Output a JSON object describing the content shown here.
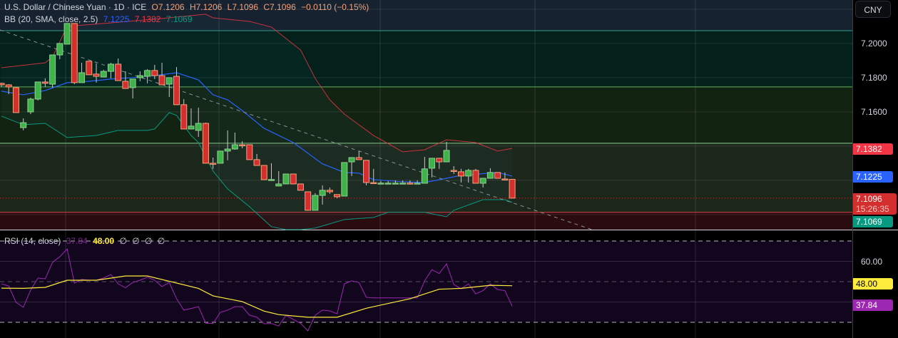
{
  "header": {
    "symbol": "U.S. Dollar / Chinese Yuan · 1D · ICE",
    "open": "O7.1206",
    "high": "H7.1206",
    "low": "L7.1096",
    "close": "C7.1096",
    "change": "−0.0110 (−0.15%)"
  },
  "bb_legend": {
    "label": "BB (20, SMA, close, 2.5)",
    "basis": "7.1225",
    "upper": "7.1382",
    "lower": "7.1069"
  },
  "rsi_legend": {
    "label": "RSI (14, close)",
    "rsi": "37.84",
    "ma": "48.00",
    "extras": [
      "∅",
      "∅",
      "∅",
      "∅"
    ]
  },
  "axis": {
    "currency": "CNY",
    "price_ticks": [
      "7.2000",
      "7.1800",
      "7.1600"
    ],
    "rsi_ticks": [
      "60.00"
    ],
    "tags": {
      "upper": "7.1382",
      "basis": "7.1225",
      "last": "7.1096",
      "countdown": "15:26:35",
      "lower": "7.1069",
      "rsi_ma": "48.00",
      "rsi": "37.84"
    }
  },
  "colors": {
    "up": "#3fb24a",
    "down": "#d32f2f",
    "basis": "#2962ff",
    "upper": "#f23645",
    "lower": "#089981",
    "rsi": "#9c27b0",
    "rsi_ma": "#ffeb3b"
  },
  "chart_data": {
    "type": "candlestick",
    "price_range": [
      7.0912,
      7.2254
    ],
    "levels": {
      "teal": 7.2075,
      "green1": 7.1746,
      "green2": 7.1417,
      "red": 7.1013
    },
    "ohlc": [
      [
        7.1767,
        7.1771,
        7.1746,
        7.1758
      ],
      [
        7.1758,
        7.1762,
        7.1704,
        7.1746
      ],
      [
        7.1742,
        7.1746,
        7.1596,
        7.1596
      ],
      [
        7.1508,
        7.1562,
        7.1492,
        7.1537
      ],
      [
        7.16,
        7.1683,
        7.1587,
        7.1675
      ],
      [
        7.1675,
        7.1775,
        7.1667,
        7.1775
      ],
      [
        7.1775,
        7.1796,
        7.1746,
        7.1767
      ],
      [
        7.1762,
        7.1933,
        7.1742,
        7.1933
      ],
      [
        7.1933,
        7.2,
        7.1908,
        7.2
      ],
      [
        7.1996,
        7.2117,
        7.1996,
        7.2117
      ],
      [
        7.2117,
        7.2117,
        7.1762,
        7.1771
      ],
      [
        7.1771,
        7.1887,
        7.1771,
        7.1829
      ],
      [
        7.1896,
        7.1896,
        7.1817,
        7.1817
      ],
      [
        7.1821,
        7.1883,
        7.1771,
        7.1808
      ],
      [
        7.1804,
        7.1846,
        7.1804,
        7.1837
      ],
      [
        7.1837,
        7.1887,
        7.1796,
        7.1879
      ],
      [
        7.1879,
        7.1912,
        7.1783,
        7.1783
      ],
      [
        7.1779,
        7.1837,
        7.1737,
        7.1737
      ],
      [
        7.1742,
        7.1792,
        7.1679,
        7.1792
      ],
      [
        7.18,
        7.1837,
        7.1779,
        7.1812
      ],
      [
        7.1808,
        7.185,
        7.1767,
        7.1842
      ],
      [
        7.1842,
        7.1875,
        7.1792,
        7.1812
      ],
      [
        7.1812,
        7.1887,
        7.1758,
        7.1758
      ],
      [
        7.1762,
        7.18,
        7.1687,
        7.18
      ],
      [
        7.1808,
        7.1862,
        7.1642,
        7.1642
      ],
      [
        7.1642,
        7.1675,
        7.15,
        7.15
      ],
      [
        7.15,
        7.1621,
        7.15,
        7.1517
      ],
      [
        7.1492,
        7.1625,
        7.1454,
        7.1533
      ],
      [
        7.1533,
        7.1537,
        7.13,
        7.13
      ],
      [
        7.13,
        7.1333,
        7.1267,
        7.1299
      ],
      [
        7.13,
        7.1371,
        7.13,
        7.1371
      ],
      [
        7.1371,
        7.1492,
        7.1317,
        7.1383
      ],
      [
        7.1383,
        7.1479,
        7.1379,
        7.1408
      ],
      [
        7.1408,
        7.1429,
        7.1387,
        7.1407
      ],
      [
        7.1408,
        7.1408,
        7.1321,
        7.1321
      ],
      [
        7.1321,
        7.1354,
        7.1287,
        7.1287
      ],
      [
        7.1287,
        7.1287,
        7.1204,
        7.1204
      ],
      [
        7.1204,
        7.13,
        7.1196,
        7.1205
      ],
      [
        7.1167,
        7.1254,
        7.1167,
        7.1179
      ],
      [
        7.1179,
        7.1237,
        7.1179,
        7.1237
      ],
      [
        7.1237,
        7.1237,
        7.1179,
        7.1179
      ],
      [
        7.1179,
        7.1179,
        7.1142,
        7.1142
      ],
      [
        7.1133,
        7.1133,
        7.1025,
        7.1025
      ],
      [
        7.1025,
        7.1125,
        7.1025,
        7.1112
      ],
      [
        7.1112,
        7.1171,
        7.1058,
        7.1142
      ],
      [
        7.1142,
        7.1158,
        7.1121,
        7.1133
      ],
      [
        7.1117,
        7.1117,
        7.1096,
        7.1104
      ],
      [
        7.1108,
        7.1304,
        7.1108,
        7.1304
      ],
      [
        7.1308,
        7.1333,
        7.1225,
        7.1333
      ],
      [
        7.1333,
        7.1371,
        7.1321,
        7.1321
      ],
      [
        7.1317,
        7.1317,
        7.1171,
        7.1187
      ],
      [
        7.1187,
        7.1267,
        7.1187,
        7.1186
      ],
      [
        7.1183,
        7.1196,
        7.1183,
        7.1184
      ],
      [
        7.1183,
        7.1196,
        7.1183,
        7.1184
      ],
      [
        7.1183,
        7.12,
        7.1183,
        7.1184
      ],
      [
        7.1183,
        7.12,
        7.1183,
        7.1184
      ],
      [
        7.1184,
        7.12,
        7.1183,
        7.1183
      ],
      [
        7.1183,
        7.12,
        7.1183,
        7.1184
      ],
      [
        7.1183,
        7.1337,
        7.1183,
        7.1267
      ],
      [
        7.1271,
        7.1329,
        7.1217,
        7.1329
      ],
      [
        7.1329,
        7.1329,
        7.1267,
        7.1308
      ],
      [
        7.1308,
        7.1425,
        7.1308,
        7.1375
      ],
      [
        7.1258,
        7.1283,
        7.1237,
        7.1257
      ],
      [
        7.125,
        7.1267,
        7.1187,
        7.1225
      ],
      [
        7.1225,
        7.1267,
        7.1187,
        7.1258
      ],
      [
        7.1258,
        7.1267,
        7.1183,
        7.1183
      ],
      [
        7.1183,
        7.1212,
        7.1158,
        7.1212
      ],
      [
        7.1212,
        7.1271,
        7.1212,
        7.1246
      ],
      [
        7.1246,
        7.1246,
        7.1212,
        7.1212
      ],
      [
        7.1208,
        7.1246,
        7.1204,
        7.1204
      ],
      [
        7.1206,
        7.1206,
        7.1096,
        7.1096
      ]
    ],
    "bb_basis": [
      [
        0,
        7.1721
      ],
      [
        3,
        7.17
      ],
      [
        6,
        7.1725
      ],
      [
        9,
        7.1771
      ],
      [
        12,
        7.1779
      ],
      [
        15,
        7.1792
      ],
      [
        18,
        7.18
      ],
      [
        21,
        7.1812
      ],
      [
        24,
        7.1829
      ],
      [
        27,
        7.1787
      ],
      [
        29,
        7.17
      ],
      [
        31,
        7.1671
      ],
      [
        33,
        7.1608
      ],
      [
        36,
        7.1504
      ],
      [
        40,
        7.1421
      ],
      [
        44,
        7.1296
      ],
      [
        47,
        7.1246
      ],
      [
        49,
        7.1242
      ],
      [
        51,
        7.1204
      ],
      [
        55,
        7.1192
      ],
      [
        58,
        7.1187
      ],
      [
        61,
        7.1212
      ],
      [
        63,
        7.1229
      ],
      [
        68,
        7.1246
      ],
      [
        70,
        7.1225
      ]
    ],
    "bb_upper": [
      [
        0,
        7.1858
      ],
      [
        6,
        7.1887
      ],
      [
        7,
        7.1921
      ],
      [
        9,
        7.21
      ],
      [
        14,
        7.2117
      ],
      [
        22,
        7.2146
      ],
      [
        28,
        7.2171
      ],
      [
        29,
        7.215
      ],
      [
        34,
        7.2129
      ],
      [
        37,
        7.2096
      ],
      [
        41,
        7.1962
      ],
      [
        43,
        7.1796
      ],
      [
        45,
        7.1671
      ],
      [
        47,
        7.1587
      ],
      [
        51,
        7.1462
      ],
      [
        55,
        7.1367
      ],
      [
        58,
        7.1379
      ],
      [
        61,
        7.1437
      ],
      [
        65,
        7.1421
      ],
      [
        68,
        7.1371
      ],
      [
        70,
        7.1387
      ]
    ],
    "bb_lower": [
      [
        0,
        7.1575
      ],
      [
        3,
        7.1525
      ],
      [
        6,
        7.1533
      ],
      [
        9,
        7.145
      ],
      [
        13,
        7.1462
      ],
      [
        16,
        7.1492
      ],
      [
        20,
        7.1492
      ],
      [
        21,
        7.15
      ],
      [
        23,
        7.1596
      ],
      [
        24,
        7.1579
      ],
      [
        26,
        7.1462
      ],
      [
        27,
        7.1421
      ],
      [
        29,
        7.1254
      ],
      [
        31,
        7.115
      ],
      [
        34,
        7.1046
      ],
      [
        37,
        7.0929
      ],
      [
        39,
        7.0912
      ],
      [
        41,
        7.0912
      ],
      [
        43,
        7.0921
      ],
      [
        47,
        7.0971
      ],
      [
        51,
        7.0983
      ],
      [
        53,
        7.1013
      ],
      [
        58,
        7.1013
      ],
      [
        61,
        7.0987
      ],
      [
        62,
        7.1025
      ],
      [
        66,
        7.1087
      ],
      [
        69,
        7.1087
      ],
      [
        70,
        7.1071
      ]
    ],
    "rsi": [
      48.9,
      47.9,
      39.8,
      37.4,
      45.8,
      51.8,
      51.4,
      59.5,
      62.3,
      66.1,
      49.3,
      51.1,
      50.7,
      50.7,
      51.8,
      53.5,
      48.9,
      47.0,
      49.6,
      50.7,
      52.2,
      50.7,
      47.6,
      49.6,
      41.6,
      36.0,
      36.8,
      37.7,
      29.6,
      29.4,
      34.9,
      36.0,
      37.7,
      37.7,
      33.5,
      32.5,
      29.3,
      29.4,
      28.2,
      33.5,
      31.4,
      29.5,
      25.8,
      33.5,
      36.0,
      35.6,
      34.2,
      48.9,
      50.4,
      49.6,
      42.3,
      42.0,
      42.0,
      42.0,
      42.0,
      42.0,
      42.0,
      42.0,
      50.4,
      55.9,
      54.0,
      58.8,
      48.6,
      46.5,
      48.9,
      44.0,
      45.6,
      48.9,
      46.1,
      45.6,
      37.84
    ],
    "rsi_ma": [
      [
        0,
        46.8
      ],
      [
        3,
        46.7
      ],
      [
        6,
        47.2
      ],
      [
        9,
        50.7
      ],
      [
        13,
        50.7
      ],
      [
        17,
        52.8
      ],
      [
        20,
        52.8
      ],
      [
        23,
        50.2
      ],
      [
        27,
        46.7
      ],
      [
        29,
        43.0
      ],
      [
        33,
        40.2
      ],
      [
        36,
        35.5
      ],
      [
        38,
        33.8
      ],
      [
        42,
        32.5
      ],
      [
        46,
        32.5
      ],
      [
        50,
        36.9
      ],
      [
        52,
        38.5
      ],
      [
        56,
        41.6
      ],
      [
        60,
        46.3
      ],
      [
        63,
        46.7
      ],
      [
        67,
        48.2
      ],
      [
        70,
        48.0
      ]
    ],
    "rsi_levels": [
      70,
      50,
      30
    ],
    "rsi_grid": [
      60,
      40
    ]
  }
}
